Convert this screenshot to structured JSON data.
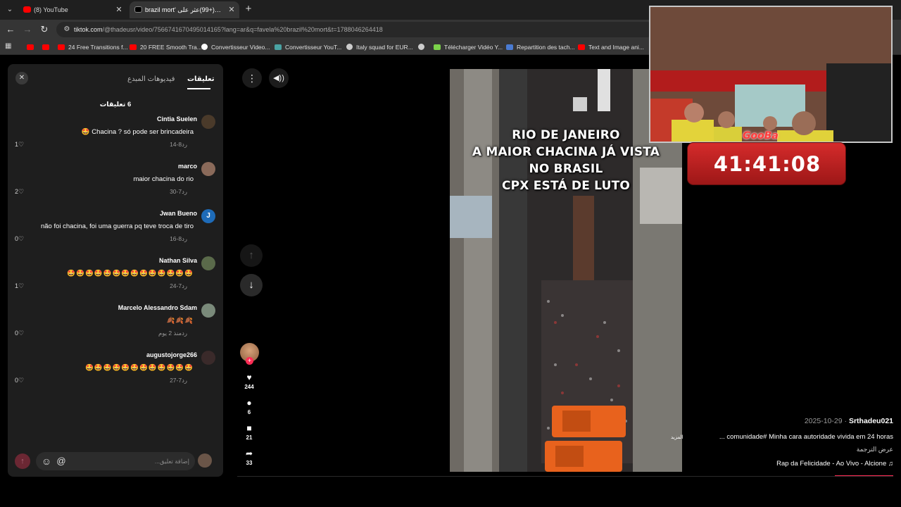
{
  "browser": {
    "tabs": [
      {
        "title": "(8) YouTube",
        "favicon_color": "#ff0000"
      },
      {
        "title": "brazil mort' على(+99)عثر على",
        "favicon_color": "#000000"
      }
    ],
    "url_host": "tiktok.com",
    "url_rest": "/@thadeusr/video/7566741670495014165?lang=ar&q=favela%20brazil%20mort&t=1788046264418",
    "bookmarks": [
      {
        "label": "",
        "color": "#ff0000"
      },
      {
        "label": "",
        "color": "#ff0000"
      },
      {
        "label": "24 Free Transitions f...",
        "color": "#ff0000"
      },
      {
        "label": "20 FREE Smooth Tra...",
        "color": "#ff0000"
      },
      {
        "label": "Convertisseur Video...",
        "color": "#ffffff"
      },
      {
        "label": "Convertisseur YouT...",
        "color": "#4aa3a3"
      },
      {
        "label": "Italy squad for EUR...",
        "color": "#cccccc"
      },
      {
        "label": "",
        "color": "#cccccc"
      },
      {
        "label": "Télécharger Vidéo Y...",
        "color": "#7bd24a"
      },
      {
        "label": "Repartition des tach...",
        "color": "#4a7bd2"
      },
      {
        "label": "Text and Image ani...",
        "color": "#ff0000"
      }
    ]
  },
  "comments_panel": {
    "close_icon": "close-icon",
    "tab_comments": "تعليقات",
    "tab_creator_videos": "فيديوهات المبدع",
    "count_label": "6 تعليقات",
    "comments": [
      {
        "user": "Cintia Suelen",
        "text": "🤩 Chacina ? só pode ser brincadeira",
        "reply": "رد",
        "date": "8-14",
        "likes": "1",
        "avatar_color": "#4a3a2a"
      },
      {
        "user": "marco",
        "text": "maior chacina do rio",
        "reply": "رد",
        "date": "7-30",
        "likes": "2",
        "avatar_color": "#8a6a5a"
      },
      {
        "user": "Jwan Bueno",
        "text": "não foi chacina, foi uma guerra pq teve troca de tiro",
        "reply": "رد",
        "date": "8-16",
        "likes": "0",
        "avatar_color": "#1e6bb8",
        "avatar_letter": "J"
      },
      {
        "user": "Nathan Silva",
        "text": "🤩🤩🤩🤩🤩🤩🤩🤩🤩🤩🤩🤩🤩🤩",
        "reply": "رد",
        "date": "7-24",
        "likes": "1",
        "avatar_color": "#5a6a4a"
      },
      {
        "user": "Marcelo Alessandro Sdam",
        "text": "🍂🍂🍂",
        "reply": "رد",
        "date": "منذ 2 يوم",
        "likes": "0",
        "avatar_color": "#7a8a7a"
      },
      {
        "user": "augustojorge266",
        "text": "🤩🤩🤩🤩🤩🤩🤩🤩🤩🤩🤩🤩",
        "reply": "رد",
        "date": "7-27",
        "likes": "0",
        "avatar_color": "#3a2a2a"
      }
    ],
    "input_placeholder": "إضافة تعليق...",
    "send_icon": "arrow-up-icon",
    "emoji_icon": "smiley-icon",
    "mention_icon": "at-icon"
  },
  "actions": {
    "likes": "244",
    "comments": "6",
    "saves": "21",
    "shares": "33"
  },
  "video": {
    "caption_lines": [
      "RIO DE JANEIRO",
      "A MAIOR CHACINA  JÁ VISTA",
      "NO BRASIL",
      "CPX ESTÁ DE LUTO"
    ],
    "more_label": "المزيد"
  },
  "stream_overlay": {
    "brand": "GooBa",
    "timer": "41:41:08",
    "timer_color": "#d52b2b"
  },
  "description": {
    "date": "2025-10-29 ·",
    "username": "Srthadeu021",
    "text": "... comunidade# Minha cara autoridade  vivida em 24 horas",
    "translate_label": "عرض الترجمة",
    "music": "Rap da Felicidade - Ao Vivo - Alcione ♫"
  },
  "colors": {
    "accent": "#fe2c55",
    "panel_bg": "#1e1e1e"
  }
}
